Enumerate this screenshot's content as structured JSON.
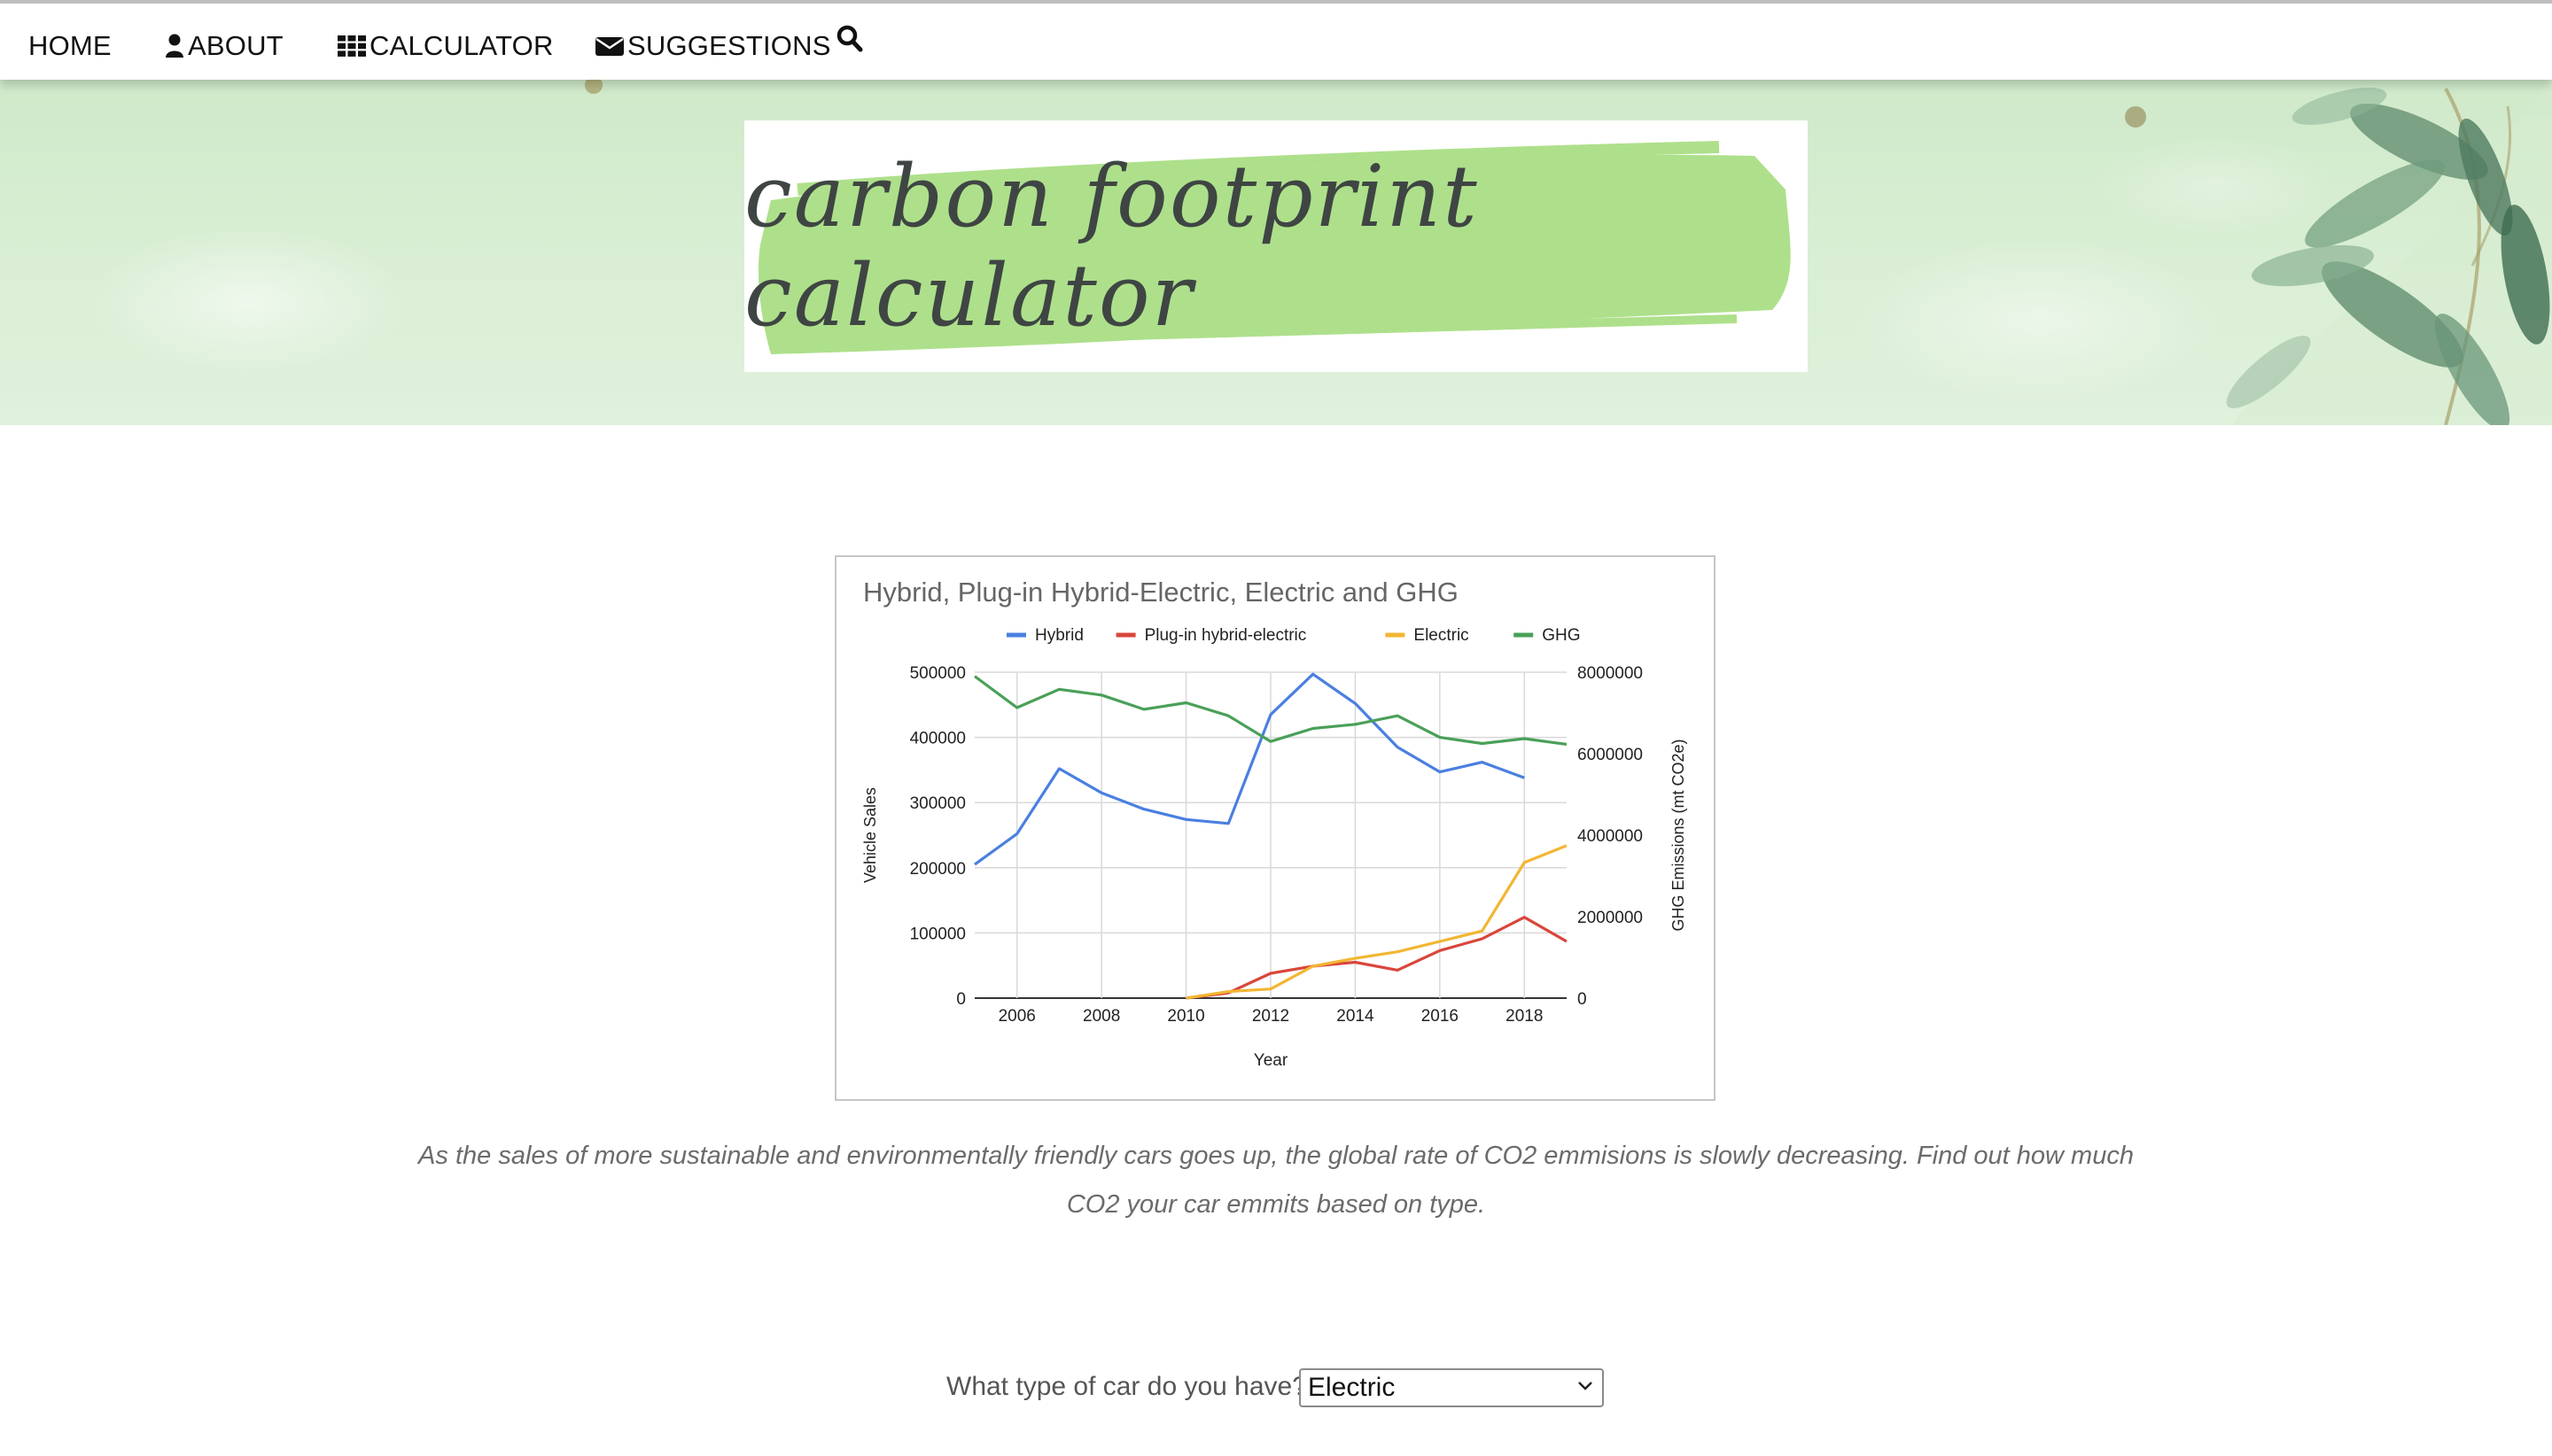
{
  "nav": {
    "home": "HOME",
    "about": "ABOUT",
    "calculator": "CALCULATOR",
    "suggestions": "SUGGESTIONS",
    "icons": {
      "about": "user-icon",
      "calculator": "grid-icon",
      "suggestions": "envelope-icon",
      "search": "search-icon"
    }
  },
  "hero": {
    "logo_text": "carbon footprint calculator",
    "logo_color": "#3f4543",
    "brush_color": "#aee08b"
  },
  "chart_data": {
    "type": "line",
    "title": "Hybrid, Plug-in Hybrid-Electric, Electric and GHG",
    "xlabel": "Year",
    "ylabel": "Vehicle Sales",
    "y2label": "GHG Emissions (mt CO2e)",
    "legend_position": "top",
    "grid": true,
    "x": [
      2005,
      2006,
      2007,
      2008,
      2009,
      2010,
      2011,
      2012,
      2013,
      2014,
      2015,
      2016,
      2017,
      2018,
      2019
    ],
    "x_ticks": [
      2006,
      2008,
      2010,
      2012,
      2014,
      2016,
      2018
    ],
    "xlim": [
      2005,
      2019
    ],
    "ylim": [
      0,
      500000
    ],
    "y_ticks": [
      0,
      100000,
      200000,
      300000,
      400000,
      500000
    ],
    "y2lim": [
      0,
      8000000
    ],
    "y2_ticks": [
      0,
      2000000,
      4000000,
      6000000,
      8000000
    ],
    "series": [
      {
        "name": "Hybrid",
        "axis": "left",
        "color": "#4a7fe0",
        "x": [
          2005,
          2006,
          2007,
          2008,
          2009,
          2010,
          2011,
          2012,
          2013,
          2014,
          2015,
          2016,
          2017,
          2018
        ],
        "values": [
          205000,
          252000,
          352000,
          315000,
          290000,
          274000,
          268000,
          435000,
          497000,
          452000,
          385000,
          347000,
          362000,
          338000
        ]
      },
      {
        "name": "Plug-in hybrid-electric",
        "axis": "left",
        "color": "#d9463b",
        "x": [
          2010,
          2011,
          2012,
          2013,
          2014,
          2015,
          2016,
          2017,
          2018,
          2019
        ],
        "values": [
          0,
          8000,
          38000,
          49000,
          55000,
          43000,
          73000,
          91000,
          124000,
          87000
        ]
      },
      {
        "name": "Electric",
        "axis": "left",
        "color": "#f2b632",
        "x": [
          2010,
          2011,
          2012,
          2013,
          2014,
          2015,
          2016,
          2017,
          2018,
          2019
        ],
        "values": [
          0,
          10000,
          14000,
          49000,
          61000,
          71000,
          87000,
          103000,
          208000,
          234000
        ]
      },
      {
        "name": "GHG",
        "axis": "right",
        "color": "#4aa058",
        "x": [
          2005,
          2006,
          2007,
          2008,
          2009,
          2010,
          2011,
          2012,
          2013,
          2014,
          2015,
          2016,
          2017,
          2018,
          2019
        ],
        "values": [
          7900000,
          7130000,
          7580000,
          7440000,
          7090000,
          7250000,
          6930000,
          6300000,
          6620000,
          6720000,
          6930000,
          6400000,
          6250000,
          6370000,
          6230000
        ]
      }
    ]
  },
  "caption": "As the sales of more sustainable and environmentally friendly cars goes up, the global rate of CO2 emmisions is slowly decreasing. Find out how much CO2 your car emmits based on type.",
  "question": {
    "label": "What type of car do you have?",
    "selected": "Electric"
  }
}
